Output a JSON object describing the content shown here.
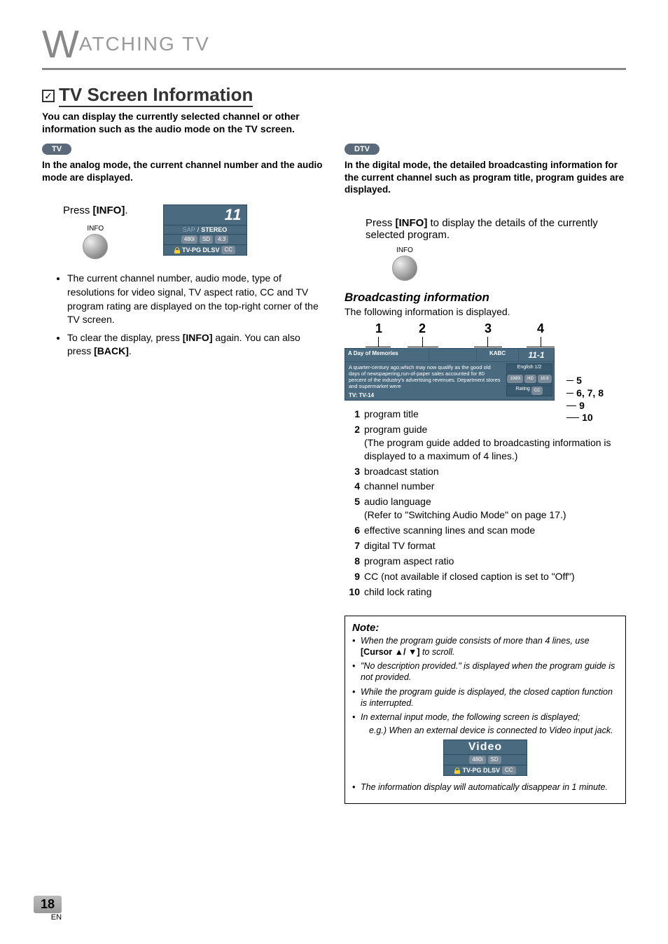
{
  "header": {
    "title_prefix": "W",
    "title_rest": "ATCHING  TV"
  },
  "section": {
    "title": "TV Screen Information",
    "intro": "You can display the currently selected channel or other information such as the audio mode on the TV screen."
  },
  "left": {
    "pill": "TV",
    "lead": "In the analog mode, the current channel number and the audio mode are displayed.",
    "step_text_pre": "Press ",
    "step_text_bold": "[INFO]",
    "step_text_post": ".",
    "info_label": "INFO",
    "osd_analog": {
      "channel": "11",
      "audio_sap": "SAP",
      "audio_sep": " / ",
      "audio_stereo": "STEREO",
      "res": "480i",
      "def": "SD",
      "aspect": "4:3",
      "rating": "TV-PG DLSV",
      "cc": "CC"
    },
    "bullets": [
      "The current channel number, audio mode, type of resolutions for video signal, TV aspect ratio, CC and TV program rating are displayed on the top-right corner of the TV screen.",
      "To clear the display, press [INFO] again. You can also press [BACK]."
    ]
  },
  "right": {
    "pill": "DTV",
    "lead": "In the digital mode, the detailed broadcasting information for the current channel such as program title, program guides are displayed.",
    "step_text": "Press [INFO] to display the details of the currently selected program.",
    "info_label": "INFO",
    "sub_head": "Broadcasting information",
    "sub_lead": "The following information is displayed.",
    "diagram_top": {
      "n1": "1",
      "n2": "2",
      "n3": "3",
      "n4": "4"
    },
    "osd_dtv": {
      "title": "A Day of Memories",
      "station": "KABC",
      "channel": "11-1",
      "desc": "A quarter-century ago,which may now qualify as the good old days of newspapering,run-of-paper sales accounted for 80 percent of the industry's advertising revenues. Department stores and supermarket were",
      "rating_line": "TV: TV-14",
      "lang": "English 1/2",
      "res": "1080i",
      "hd": "HD",
      "aspect": "16:9",
      "rating_label": "Rating",
      "cc": "CC"
    },
    "callouts": {
      "c5": "5",
      "c678": "6, 7, 8",
      "c9": "9",
      "c10": "10"
    },
    "list": [
      {
        "n": "1",
        "t": "program title"
      },
      {
        "n": "2",
        "t": "program guide\n(The program guide added to broadcasting information is displayed to a maximum of 4 lines.)"
      },
      {
        "n": "3",
        "t": "broadcast station"
      },
      {
        "n": "4",
        "t": "channel number"
      },
      {
        "n": "5",
        "t": "audio language\n(Refer to \"Switching Audio Mode\" on page 17.)"
      },
      {
        "n": "6",
        "t": "effective scanning lines and scan mode"
      },
      {
        "n": "7",
        "t": "digital TV format"
      },
      {
        "n": "8",
        "t": "program aspect ratio"
      },
      {
        "n": "9",
        "t": "CC (not available if closed caption is set to \"Off\")"
      },
      {
        "n": "10",
        "t": "child lock rating"
      }
    ],
    "note": {
      "title": "Note:",
      "items": [
        "When the program guide consists of more than 4 lines, use [Cursor ▲/ ▼] to scroll.",
        "\"No description provided.\" is displayed when the program guide is not provided.",
        "While the program guide is displayed, the closed caption function is interrupted.",
        "In external input mode, the following screen is displayed;"
      ],
      "eg": "e.g.) When an external device is connected to Video input jack.",
      "osd_video": {
        "label": "Video",
        "res": "480i",
        "def": "SD",
        "rating": "TV-PG DLSV",
        "cc": "CC"
      },
      "last_item": "The information display will automatically disappear in 1 minute."
    }
  },
  "footer": {
    "page": "18",
    "lang": "EN"
  }
}
